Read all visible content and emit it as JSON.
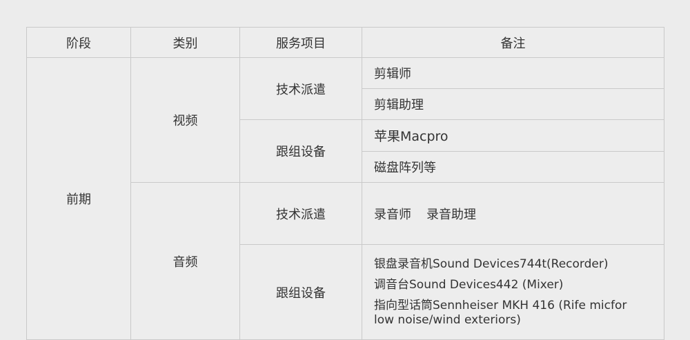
{
  "headers": {
    "stage": "阶段",
    "category": "类别",
    "service": "服务项目",
    "notes": "备注"
  },
  "rows": {
    "stage": "前期",
    "video": {
      "category": "视频",
      "tech": {
        "service": "技术派遣",
        "note1": "剪辑师",
        "note2": "剪辑助理"
      },
      "equipment": {
        "service": "跟组设备",
        "note1": "苹果Macpro",
        "note2": "磁盘阵列等"
      }
    },
    "audio": {
      "category": "音频",
      "tech": {
        "service": "技术派遣",
        "note_a": "录音师",
        "note_b": "录音助理"
      },
      "equipment": {
        "service": "跟组设备",
        "line1": "银盘录音机Sound Devices744t(Recorder)",
        "line2": "调音台Sound Devices442 (Mixer)",
        "line3": "指向型话筒Sennheiser MKH 416 (Rife micfor",
        "line4": "low noise/wind exteriors)"
      }
    }
  }
}
